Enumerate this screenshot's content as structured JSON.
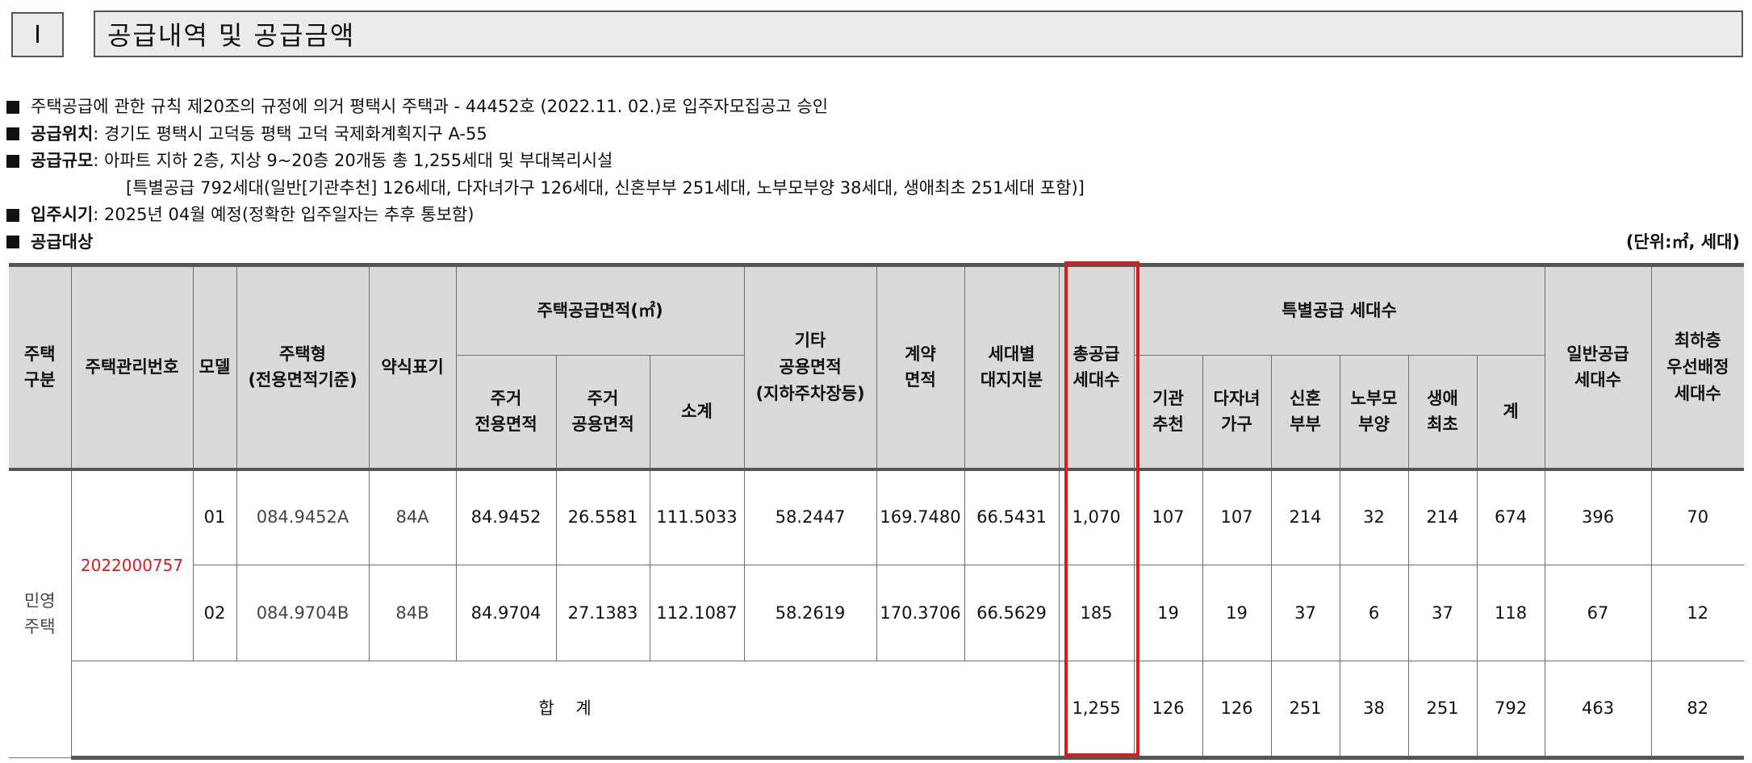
{
  "section": {
    "number": "Ⅰ",
    "title": "공급내역 및 공급금액"
  },
  "info": {
    "line1": "주택공급에 관한 규칙 제20조의 규정에 의거 평택시 주택과 - 44452호 (2022.11. 02.)로 입주자모집공고 승인",
    "location_label": "공급위치",
    "location_value": " : 경기도 평택시 고덕동 평택 고덕 국제화계획지구 A-55",
    "scale_label": "공급규모",
    "scale_value": " : 아파트 지하 2층, 지상 9~20층 20개동 총 1,255세대 및 부대복리시설",
    "scale_detail": "[특별공급 792세대(일반[기관추천] 126세대, 다자녀가구 126세대, 신혼부부 251세대, 노부모부양 38세대, 생애최초 251세대 포함)]",
    "movein_label": "입주시기",
    "movein_value": " : 2025년 04월 예정(정확한 입주일자는 추후 통보함)",
    "target_label": "공급대상",
    "unit": "(단위:㎡, 세대)"
  },
  "table": {
    "headers": {
      "housing_category": "주택\n구분",
      "management_no": "주택관리번호",
      "model": "모델",
      "house_type": "주택형\n(전용면적기준)",
      "abbrev": "약식표기",
      "supply_area_group": "주택공급면적(㎡)",
      "exclusive_area": "주거\n전용면적",
      "common_area": "주거\n공용면적",
      "subtotal": "소계",
      "other_common": "기타\n공용면적\n(지하주차장등)",
      "contract_area": "계약\n면적",
      "land_share": "세대별\n대지지분",
      "total_supply": "총공급\n세대수",
      "special_group": "특별공급 세대수",
      "agency": "기관\n추천",
      "multi_child": "다자녀\n가구",
      "newlywed": "신혼\n부부",
      "elderly_parent": "노부모\n부양",
      "first_time": "생애\n최초",
      "special_total": "계",
      "general_supply": "일반공급\n세대수",
      "lowest_floor": "최하층\n우선배정\n세대수"
    },
    "housing_category": "민영\n주택",
    "management_no": "2022000757",
    "rows": [
      {
        "model": "01",
        "house_type": "084.9452A",
        "abbrev": "84A",
        "exclusive": "84.9452",
        "common": "26.5581",
        "subtotal": "111.5033",
        "other_common": "58.2447",
        "contract": "169.7480",
        "land_share": "66.5431",
        "total_supply": "1,070",
        "agency": "107",
        "multi_child": "107",
        "newlywed": "214",
        "elderly": "32",
        "first_time": "214",
        "special_total": "674",
        "general": "396",
        "lowest_floor": "70"
      },
      {
        "model": "02",
        "house_type": "084.9704B",
        "abbrev": "84B",
        "exclusive": "84.9704",
        "common": "27.1383",
        "subtotal": "112.1087",
        "other_common": "58.2619",
        "contract": "170.3706",
        "land_share": "66.5629",
        "total_supply": "185",
        "agency": "19",
        "multi_child": "19",
        "newlywed": "37",
        "elderly": "6",
        "first_time": "37",
        "special_total": "118",
        "general": "67",
        "lowest_floor": "12"
      }
    ],
    "total_row": {
      "label": "합    계",
      "total_supply": "1,255",
      "agency": "126",
      "multi_child": "126",
      "newlywed": "251",
      "elderly": "38",
      "first_time": "251",
      "special_total": "792",
      "general": "463",
      "lowest_floor": "82"
    }
  },
  "colors": {
    "highlight": "#e01919",
    "management_no": "#d21f1f",
    "header_bg": "#dadada"
  }
}
